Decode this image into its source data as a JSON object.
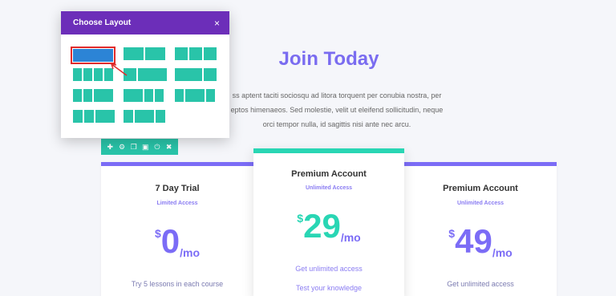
{
  "hero": {
    "title": "Join Today",
    "lines": [
      "ss aptent taciti sociosqu ad litora torquent per conubia nostra, per",
      "eptos himenaeos. Sed molestie, velit ut eleifend sollicitudin, neque",
      "orci tempor nulla, id sagittis nisi ante nec arcu."
    ]
  },
  "modal": {
    "title": "Choose Layout",
    "close": "×"
  },
  "toolbar": {
    "icons": [
      "plus-icon",
      "gear-icon",
      "duplicate-icon",
      "save-icon",
      "power-icon",
      "trash-icon"
    ]
  },
  "cards": [
    {
      "title": "7 Day Trial",
      "subtitle": "Limited Access",
      "currency": "$",
      "amount": "0",
      "per": "/mo",
      "features": [
        "Try 5 lessons in each course"
      ]
    },
    {
      "title": "Premium Account",
      "subtitle": "Unlimited Access",
      "currency": "$",
      "amount": "29",
      "per": "/mo",
      "features": [
        "Get unlimited access",
        "Test your knowledge"
      ]
    },
    {
      "title": "Premium Account",
      "subtitle": "Unlimited Access",
      "currency": "$",
      "amount": "49",
      "per": "/mo",
      "features": [
        "Get unlimited access"
      ]
    }
  ],
  "colors": {
    "modal_header": "#6c2eb9",
    "teal": "#29c4a9",
    "purple": "#7b6cf6",
    "selected_layout": "#2c84d6",
    "highlight": "#e02b2b"
  }
}
